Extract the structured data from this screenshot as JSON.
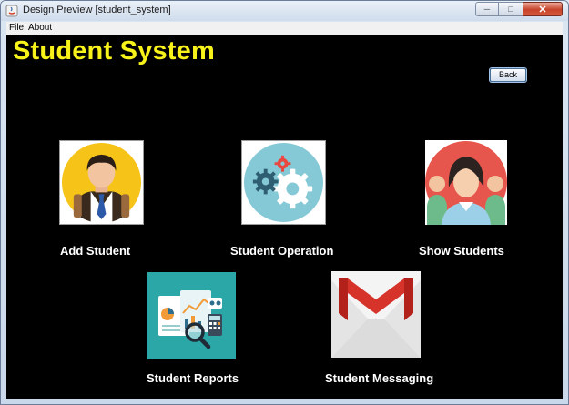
{
  "window": {
    "title": "Design Preview [student_system]",
    "controls": [
      "minimize-icon",
      "maximize-icon",
      "close-icon"
    ]
  },
  "menu": {
    "file": "File",
    "about": "About"
  },
  "app": {
    "title": "Student System",
    "title_color": "#f7f31a",
    "back_label": "Back"
  },
  "tiles": {
    "add_student": {
      "label": "Add Student",
      "icon": "student-avatar-icon"
    },
    "student_operation": {
      "label": "Student Operation",
      "icon": "gears-icon"
    },
    "show_students": {
      "label": "Show Students",
      "icon": "students-group-icon"
    },
    "student_reports": {
      "label": "Student Reports",
      "icon": "reports-icon"
    },
    "student_messaging": {
      "label": "Student Messaging",
      "icon": "mail-icon"
    }
  }
}
